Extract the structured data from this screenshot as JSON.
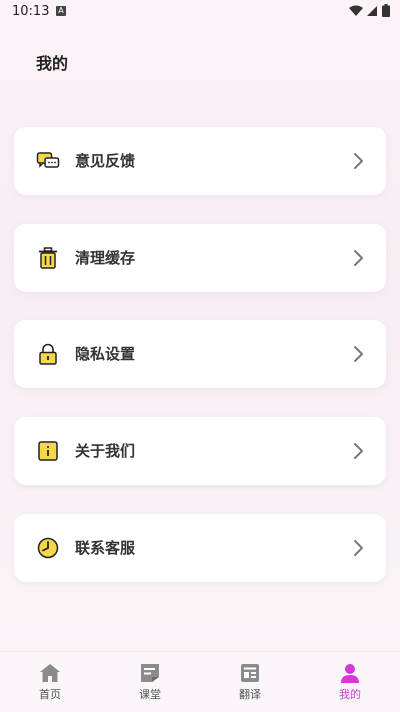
{
  "status_bar": {
    "time": "10:13",
    "notification_letter": "A"
  },
  "page": {
    "title": "我的"
  },
  "menu": [
    {
      "label": "意见反馈",
      "icon": "chat-bubbles-icon"
    },
    {
      "label": "清理缓存",
      "icon": "trash-icon"
    },
    {
      "label": "隐私设置",
      "icon": "lock-icon"
    },
    {
      "label": "关于我们",
      "icon": "info-icon"
    },
    {
      "label": "联系客服",
      "icon": "clock-icon"
    }
  ],
  "tabbar": {
    "items": [
      {
        "label": "首页",
        "icon": "home-icon"
      },
      {
        "label": "课堂",
        "icon": "note-icon"
      },
      {
        "label": "翻译",
        "icon": "translate-icon"
      },
      {
        "label": "我的",
        "icon": "person-icon"
      }
    ],
    "active_color": "#d23bd6",
    "inactive_color": "#555555"
  },
  "colors": {
    "icon_accent": "#f5d84a",
    "icon_stroke": "#222222"
  }
}
